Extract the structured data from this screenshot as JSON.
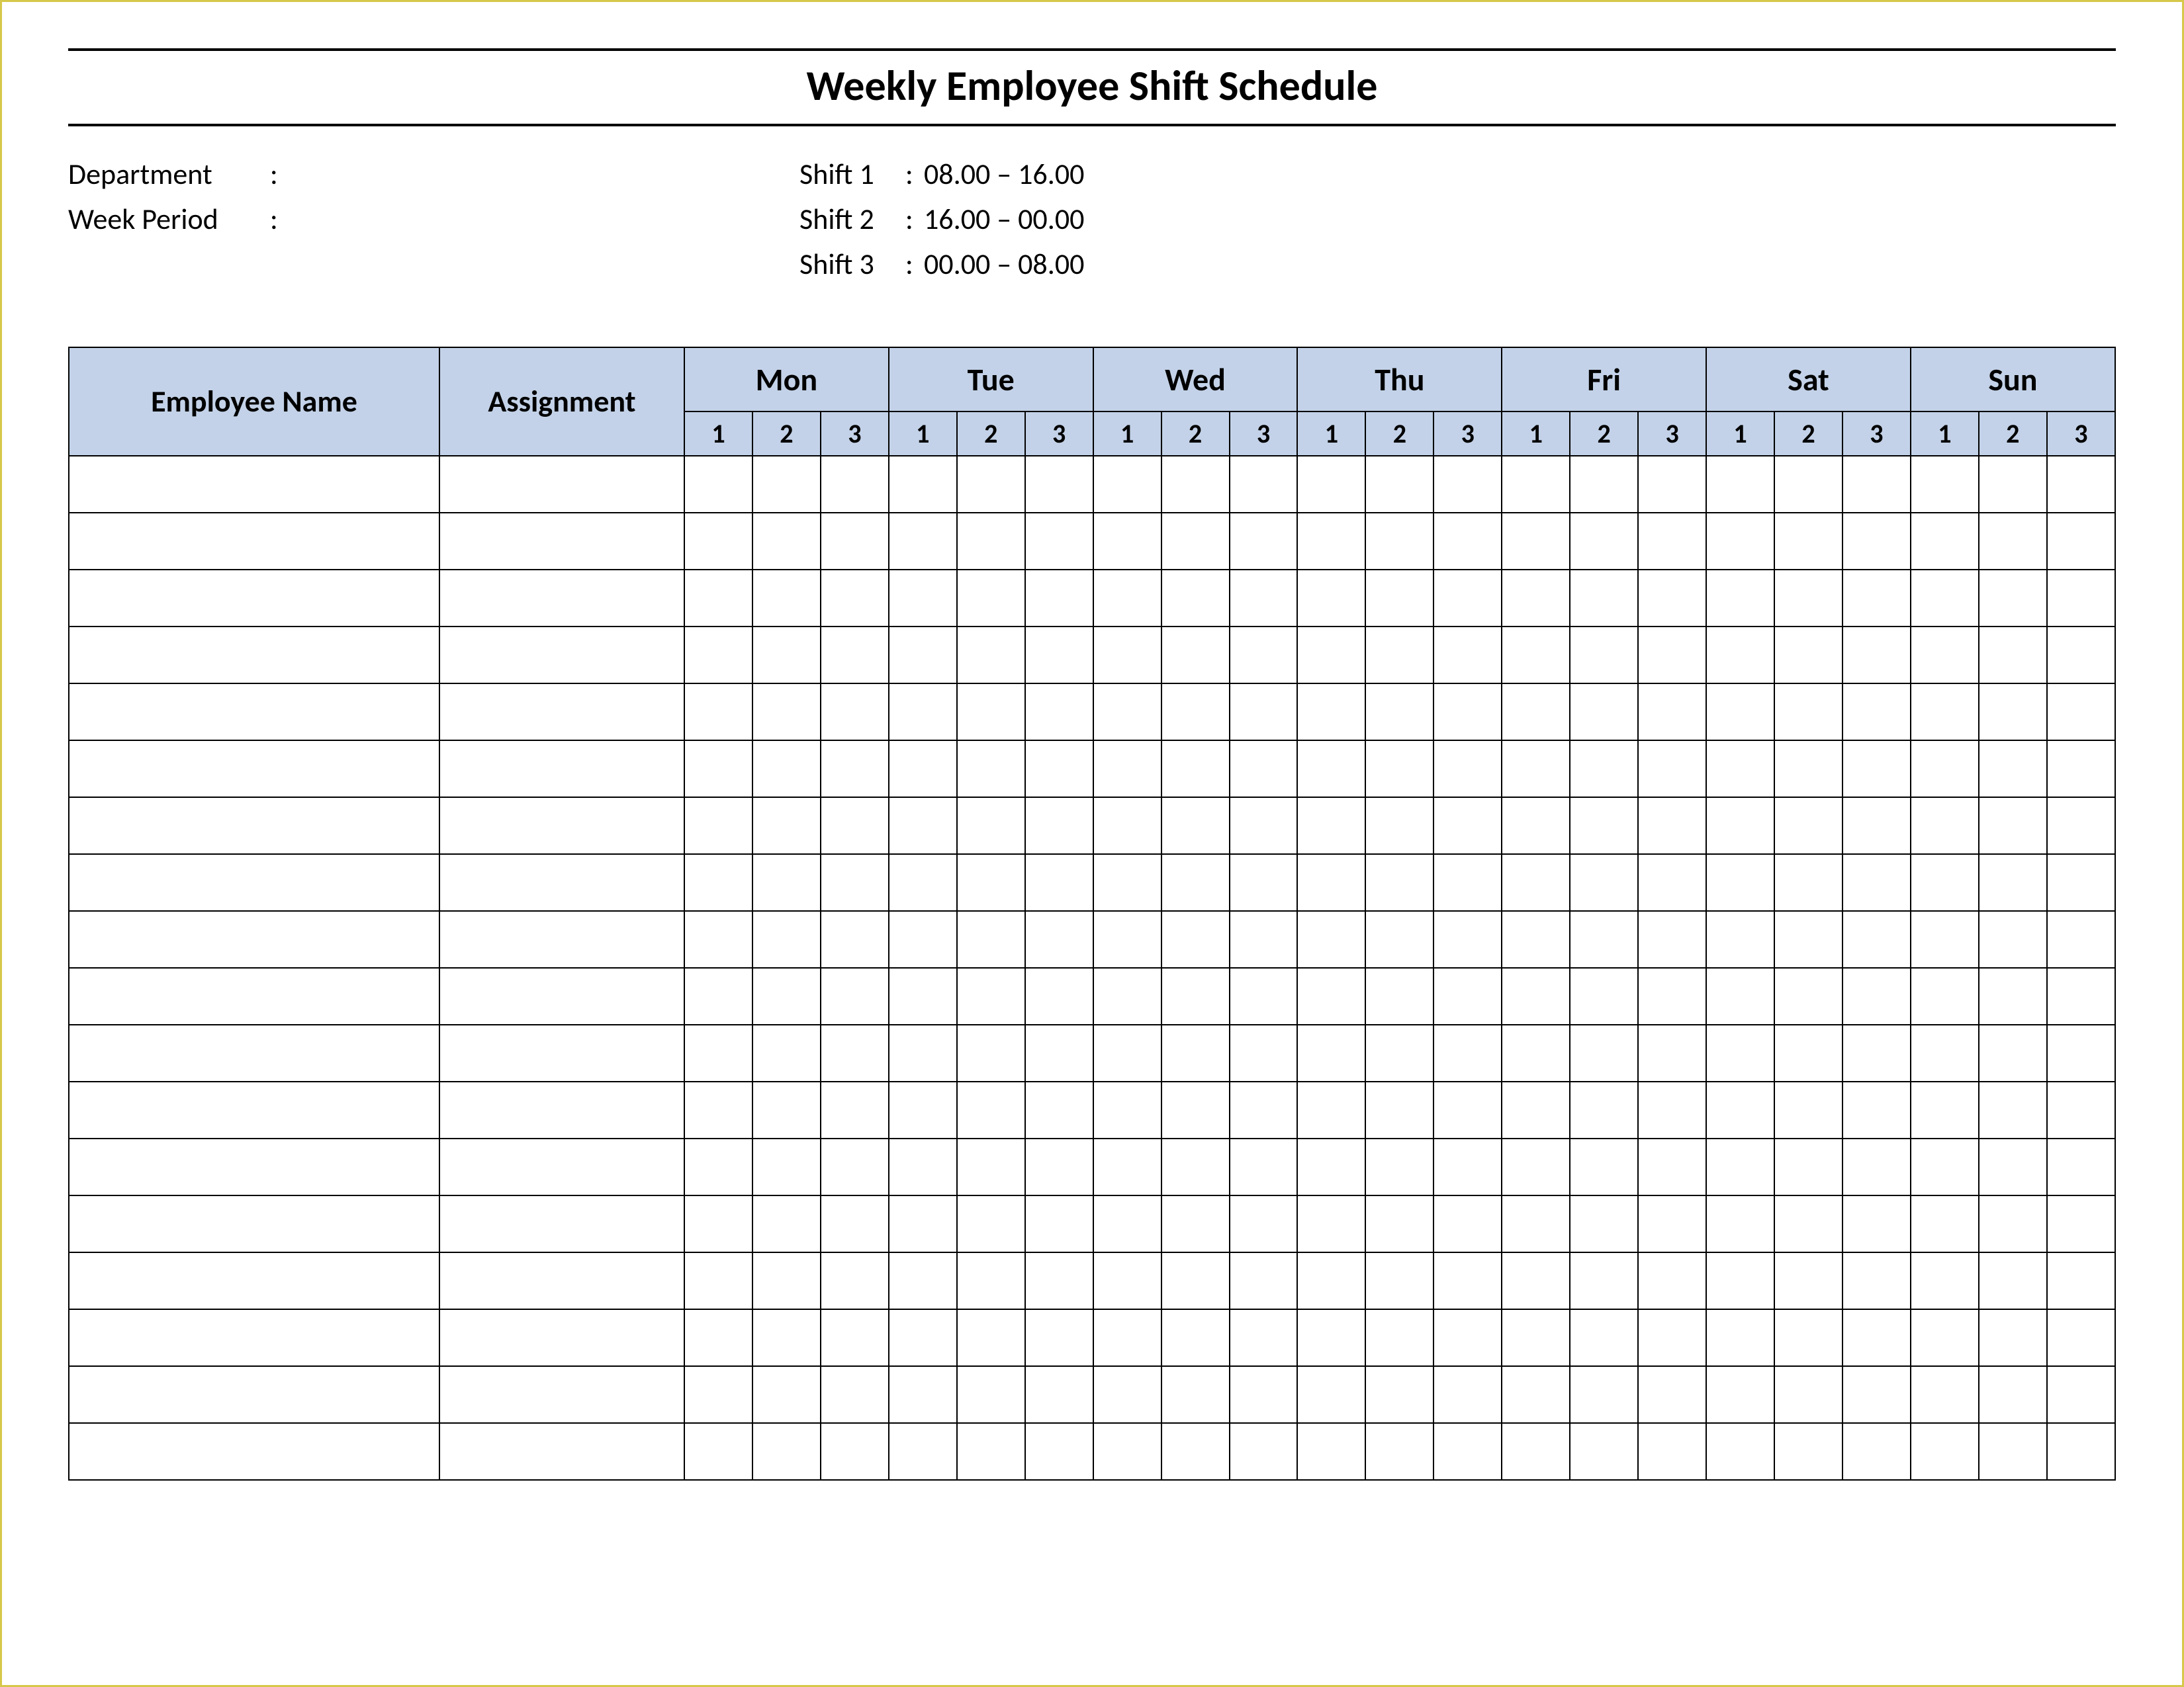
{
  "title": "Weekly Employee Shift Schedule",
  "meta": {
    "department_label": "Department",
    "department_value": "",
    "week_period_label": "Week  Period",
    "week_period_value": ""
  },
  "shifts": [
    {
      "label": "Shift 1",
      "time": "08.00  – 16.00"
    },
    {
      "label": "Shift 2",
      "time": "16.00  – 00.00"
    },
    {
      "label": "Shift 3",
      "time": "00.00  – 08.00"
    }
  ],
  "columns": {
    "employee_name": "Employee Name",
    "assignment": "Assignment",
    "days": [
      "Mon",
      "Tue",
      "Wed",
      "Thu",
      "Fri",
      "Sat",
      "Sun"
    ],
    "shift_nums": [
      "1",
      "2",
      "3"
    ]
  },
  "row_count": 18
}
